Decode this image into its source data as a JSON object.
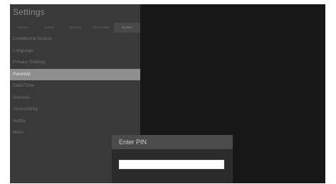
{
  "settings": {
    "title": "Settings",
    "tabs": [
      "Picture",
      "Sound",
      "Network",
      "Timer/Alarm",
      "System"
    ],
    "active_tab": "System",
    "menu": [
      "Conditional Access",
      "Language",
      "Privacy Settings",
      "Parental",
      "Date/Time",
      "Sources",
      "Accessibility",
      "Netflix",
      "More"
    ],
    "selected_item": "Parental"
  },
  "pin_dialog": {
    "title": "Enter PIN",
    "value": ""
  },
  "colors": {
    "screen_background": "#171717",
    "panel_background": "#393939",
    "selected_row": "#8f8f8f",
    "dialog_header": "#4b4b4b",
    "dialog_body": "#2b2b2b"
  }
}
